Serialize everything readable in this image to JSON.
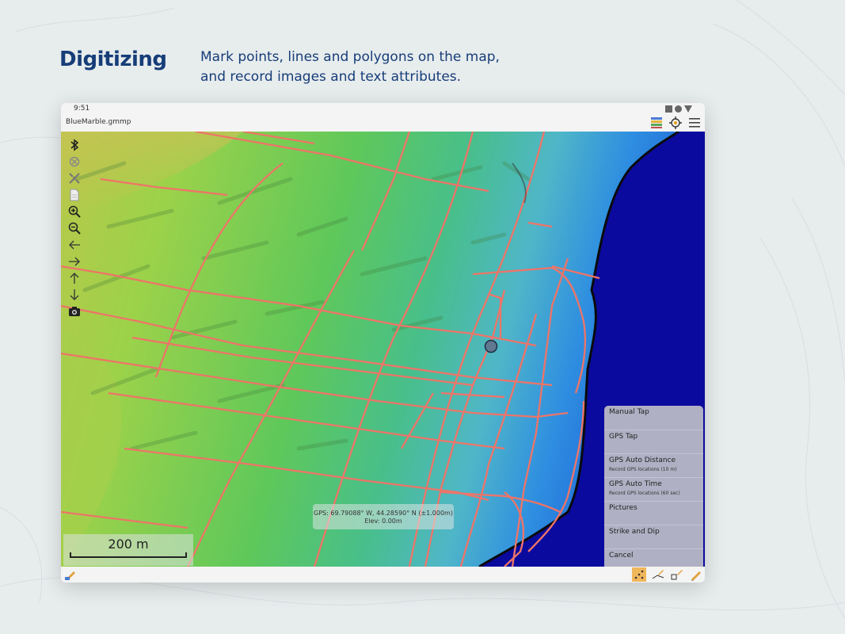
{
  "header": {
    "title": "Digitizing",
    "subtitle_lines": [
      "Mark points, lines and polygons on the map,",
      "and record images and text attributes."
    ]
  },
  "device": {
    "status_time": "9:51",
    "file_name": "BlueMarble.gmmp",
    "appbar_icons": [
      "layers-icon",
      "gps-target-icon",
      "hamburger-menu-icon"
    ],
    "map_tools": [
      "bluetooth-icon",
      "gps-off-icon",
      "satellite-icon",
      "document-icon",
      "zoom-in-icon",
      "zoom-out-icon",
      "arrow-left-icon",
      "arrow-right-icon",
      "arrow-up-icon",
      "arrow-down-icon",
      "camera-icon"
    ],
    "scale_label": "200 m",
    "gps_readout": {
      "line1": "GPS:   69.79088° W, 44.28590° N (±1.000m)",
      "line2": "Elev: 0.00m"
    },
    "digitize_menu": [
      {
        "label": "Manual Tap",
        "sub": ""
      },
      {
        "label": "GPS Tap",
        "sub": ""
      },
      {
        "label": "GPS Auto Distance",
        "sub": "Record GPS locations (10 m)"
      },
      {
        "label": "GPS Auto Time",
        "sub": "Record GPS locations (60 sec)"
      },
      {
        "label": "Pictures",
        "sub": ""
      },
      {
        "label": "Strike and Dip",
        "sub": ""
      },
      {
        "label": "Cancel",
        "sub": ""
      }
    ],
    "bottom_tools": [
      "point-tool-icon",
      "line-tool-icon",
      "polygon-tool-icon",
      "pencil-tool-icon"
    ],
    "colors": {
      "heading": "#163d78",
      "roads": "#ee7468",
      "water": "#0a0a9e",
      "active_tool": "#f0b65c"
    }
  }
}
